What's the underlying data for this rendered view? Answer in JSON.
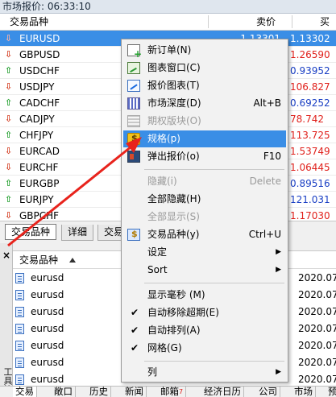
{
  "market_watch": {
    "title": "市场报价: 06:33:10",
    "columns": {
      "symbol": "交易品种",
      "bid": "卖价",
      "ask": "买价"
    },
    "rows": [
      {
        "symbol": "EURUSD",
        "dir": "down",
        "bid": "1.13301",
        "ask": "1.13302",
        "ask_color": "blue",
        "selected": true
      },
      {
        "symbol": "GBPUSD",
        "dir": "down",
        "bid": "",
        "ask": "1.26590",
        "ask_color": "red"
      },
      {
        "symbol": "USDCHF",
        "dir": "up",
        "bid": "",
        "ask": "0.93952",
        "ask_color": "blue"
      },
      {
        "symbol": "USDJPY",
        "dir": "down",
        "bid": "",
        "ask": "106.827",
        "ask_color": "red"
      },
      {
        "symbol": "CADCHF",
        "dir": "up",
        "bid": "",
        "ask": "0.69252",
        "ask_color": "blue"
      },
      {
        "symbol": "CADJPY",
        "dir": "down",
        "bid": "",
        "ask": "78.742",
        "ask_color": "red"
      },
      {
        "symbol": "CHFJPY",
        "dir": "up",
        "bid": "",
        "ask": "113.725",
        "ask_color": "red"
      },
      {
        "symbol": "EURCAD",
        "dir": "down",
        "bid": "",
        "ask": "1.53749",
        "ask_color": "red"
      },
      {
        "symbol": "EURCHF",
        "dir": "down",
        "bid": "",
        "ask": "1.06445",
        "ask_color": "red"
      },
      {
        "symbol": "EURGBP",
        "dir": "up",
        "bid": "",
        "ask": "0.89516",
        "ask_color": "blue"
      },
      {
        "symbol": "EURJPY",
        "dir": "up",
        "bid": "",
        "ask": "121.031",
        "ask_color": "blue"
      },
      {
        "symbol": "GBPCHF",
        "dir": "down",
        "bid": "",
        "ask": "1.17030",
        "ask_color": "red"
      }
    ],
    "tabs": [
      "交易品种",
      "详细",
      "交易"
    ]
  },
  "toolbox": {
    "side_close": "×",
    "side_label": "工具箱",
    "header": "交易品种",
    "rows": [
      {
        "name": "eurusd",
        "date": "2020.07"
      },
      {
        "name": "eurusd",
        "date": "2020.07"
      },
      {
        "name": "eurusd",
        "date": "2020.07"
      },
      {
        "name": "eurusd",
        "date": "2020.07"
      },
      {
        "name": "eurusd",
        "date": "2020.07"
      },
      {
        "name": "eurusd",
        "date": "2020.07"
      },
      {
        "name": "eurusd",
        "date": "2020.07"
      }
    ],
    "bottom_tabs": [
      {
        "label": "交易",
        "active": true
      },
      {
        "label": "敞口"
      },
      {
        "label": "历史"
      },
      {
        "label": "新闻"
      },
      {
        "label": "邮箱",
        "badge": "7"
      },
      {
        "label": "经济日历"
      },
      {
        "label": "公司"
      },
      {
        "label": "市场"
      },
      {
        "label": "预"
      }
    ]
  },
  "context_menu": {
    "items": [
      {
        "label": "新订单(N)",
        "icon": "new-order-icon"
      },
      {
        "label": "图表窗口(C)",
        "icon": "chart-window-icon"
      },
      {
        "label": "报价图表(T)",
        "icon": "tick-chart-icon"
      },
      {
        "label": "市场深度(D)",
        "shortcut": "Alt+B",
        "icon": "depth-of-market-icon"
      },
      {
        "label": "期权版块(O)",
        "disabled": true,
        "icon": "options-board-icon"
      },
      {
        "label": "规格(p)",
        "highlighted": true,
        "icon": "specification-icon"
      },
      {
        "label": "弹出报价(o)",
        "shortcut": "F10",
        "icon": "popup-prices-icon"
      },
      {
        "label": "隐藏(i)",
        "shortcut": "Delete",
        "disabled": true
      },
      {
        "label": "全部隐藏(H)"
      },
      {
        "label": "全部显示(S)",
        "disabled": true
      },
      {
        "label": "交易品种(y)",
        "shortcut": "Ctrl+U",
        "icon": "symbols-icon"
      },
      {
        "label": "设定",
        "submenu": true
      },
      {
        "label": "Sort",
        "submenu": true
      },
      {
        "label": "显示毫秒 (M)"
      },
      {
        "label": "自动移除超期(E)",
        "checked": true
      },
      {
        "label": "自动排列(A)",
        "checked": true
      },
      {
        "label": "网格(G)",
        "checked": true
      },
      {
        "label": "列",
        "submenu": true
      }
    ]
  },
  "colors": {
    "selection": "#3a8ee6",
    "up": "#1e9e2a",
    "down": "#d43b1f",
    "ask_red": "#e0201b",
    "ask_blue": "#1a3fc4",
    "annotation": "#e8231c"
  }
}
